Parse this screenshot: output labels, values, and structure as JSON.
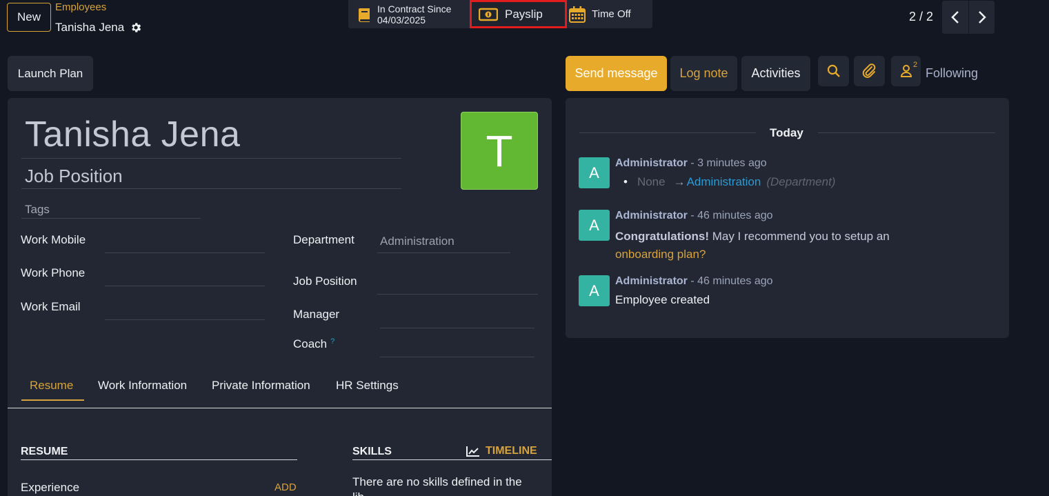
{
  "control_panel": {
    "new_label": "New",
    "breadcrumb_parent": "Employees",
    "breadcrumb_current": "Tanisha Jena",
    "pager": "2 / 2"
  },
  "smart_buttons": {
    "contract_line1": "In Contract Since",
    "contract_line2": "04/03/2025",
    "payslip": "Payslip",
    "time_off": "Time Off"
  },
  "actions": {
    "launch_plan": "Launch Plan"
  },
  "form": {
    "name": "Tanisha Jena",
    "job_position_placeholder": "Job Position",
    "tags_placeholder": "Tags",
    "avatar_letter": "T",
    "fields": {
      "work_mobile": "Work Mobile",
      "work_phone": "Work Phone",
      "work_email": "Work Email",
      "department": "Department",
      "department_value": "Administration",
      "job_position": "Job Position",
      "manager": "Manager",
      "coach": "Coach",
      "coach_help": "?"
    },
    "tabs": [
      "Resume",
      "Work Information",
      "Private Information",
      "HR Settings"
    ],
    "resume": {
      "title": "RESUME",
      "experience": "Experience",
      "add": "ADD"
    },
    "skills": {
      "title": "SKILLS",
      "timeline": "TIMELINE",
      "empty": "There are no skills defined in the lib..."
    }
  },
  "chatter": {
    "send_message": "Send message",
    "log_note": "Log note",
    "activities": "Activities",
    "follower_count": "2",
    "following": "Following",
    "date_separator": "Today",
    "messages": [
      {
        "avatar": "A",
        "author": "Administrator",
        "time": " - 3 minutes ago",
        "old_value": "None",
        "arrow": "→",
        "new_value": "Administration",
        "field": "(Department)"
      },
      {
        "avatar": "A",
        "author": "Administrator",
        "time": " - 46 minutes ago",
        "bold": "Congratulations!",
        "text": " May I recommend you to setup an",
        "link": "onboarding plan?"
      },
      {
        "avatar": "A",
        "author": "Administrator",
        "time": " - 46 minutes ago",
        "text": "Employee created"
      }
    ]
  },
  "colors": {
    "accent": "#e8aa2b",
    "background": "#131722",
    "panel": "#222733",
    "avatar_green": "#62b733",
    "avatar_teal": "#34b3a2",
    "highlight_red": "#e21c1c"
  }
}
